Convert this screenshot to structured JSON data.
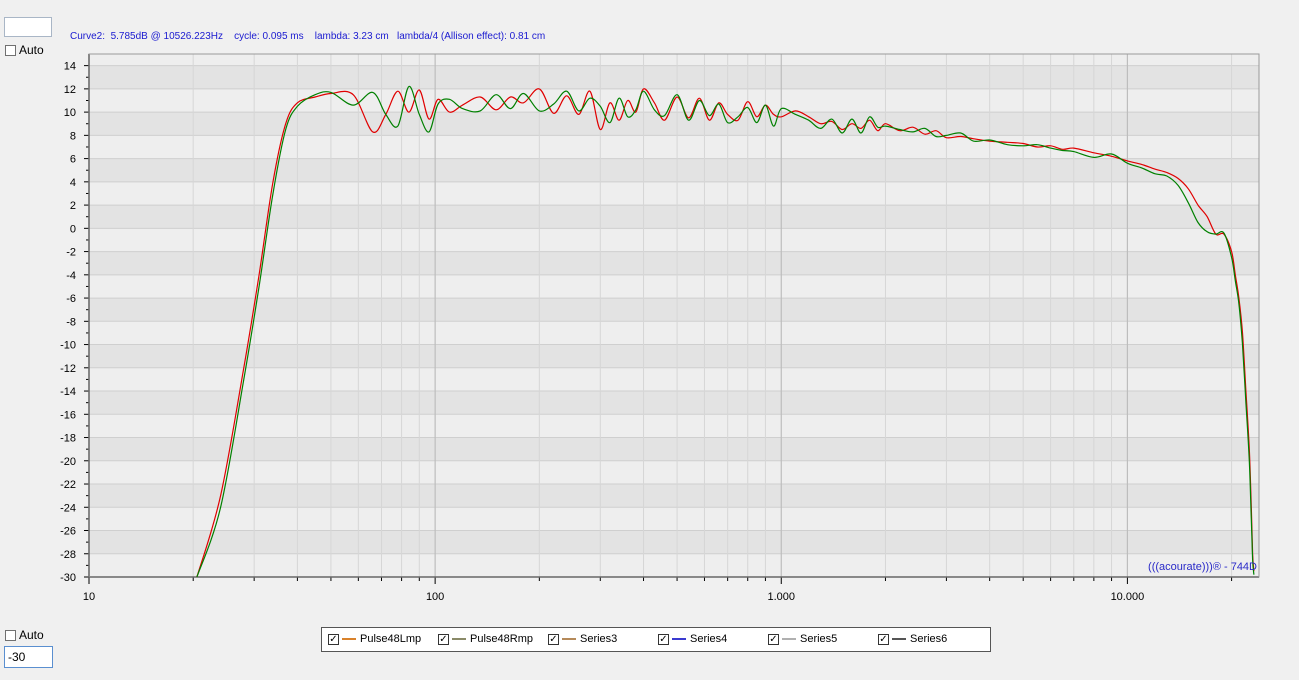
{
  "readout": "Curve2:  5.785dB @ 10526.223Hz    cycle: 0.095 ms    lambda: 3.23 cm   lambda/4 (Allison effect): 0.81 cm",
  "top_control": {
    "auto_label": "Auto",
    "value": ""
  },
  "bottom_control": {
    "auto_label": "Auto",
    "value": "-30"
  },
  "watermark": "(((acourate)))® - 744D",
  "legend": [
    {
      "name": "Pulse48Lmp",
      "color": "#d9822b"
    },
    {
      "name": "Pulse48Rmp",
      "color": "#8a8a68"
    },
    {
      "name": "Series3",
      "color": "#b58a5a"
    },
    {
      "name": "Series4",
      "color": "#3a3ad0"
    },
    {
      "name": "Series5",
      "color": "#b0b0b0"
    },
    {
      "name": "Series6",
      "color": "#555555"
    }
  ],
  "colors": {
    "red_curve": "#e00000",
    "green_curve": "#008000",
    "plot_bg_a": "#eeeeee",
    "plot_bg_b": "#e3e3e3"
  },
  "chart_data": {
    "type": "line",
    "xscale": "log",
    "xlim": [
      10,
      24000
    ],
    "ylim": [
      -30,
      15
    ],
    "xticks": [
      10,
      100,
      1000,
      10000
    ],
    "xtick_labels": [
      "10",
      "100",
      "1.000",
      "10.000"
    ],
    "yticks": [
      14,
      12,
      10,
      8,
      6,
      4,
      2,
      0,
      -2,
      -4,
      -6,
      -8,
      -10,
      -12,
      -14,
      -16,
      -18,
      -20,
      -22,
      -24,
      -26,
      -28,
      -30
    ],
    "grid": true,
    "series": [
      {
        "color": "#e00000",
        "x": [
          20.5,
          24,
          28,
          31,
          34,
          37,
          40,
          45,
          50,
          58,
          66,
          72,
          78,
          84,
          90,
          96,
          102,
          110,
          120,
          135,
          150,
          165,
          180,
          200,
          220,
          240,
          260,
          280,
          300,
          320,
          340,
          360,
          380,
          400,
          430,
          460,
          500,
          540,
          580,
          620,
          660,
          700,
          750,
          800,
          850,
          900,
          950,
          1000,
          1100,
          1200,
          1300,
          1400,
          1500,
          1600,
          1700,
          1800,
          1900,
          2000,
          2200,
          2400,
          2600,
          2800,
          3000,
          3300,
          3600,
          4000,
          4500,
          5000,
          5500,
          6000,
          6500,
          7000,
          8000,
          9000,
          10000,
          11000,
          12000,
          13000,
          14000,
          15000,
          16000,
          17000,
          18000,
          19000,
          20000,
          20500,
          21000,
          21500,
          22000,
          22500,
          22800,
          23000,
          23200
        ],
        "y": [
          -30,
          -23,
          -12,
          -4,
          4,
          9,
          10.8,
          11.3,
          11.6,
          11.5,
          8.3,
          9.8,
          11.8,
          10,
          11.9,
          9.4,
          11.1,
          10,
          10.6,
          11.3,
          10.2,
          11.3,
          10.8,
          12,
          9.9,
          11.4,
          9.8,
          11.8,
          8.5,
          10.8,
          9.3,
          11,
          10,
          12,
          10.8,
          9.3,
          11.3,
          9.5,
          11.2,
          9.3,
          10.8,
          9.8,
          9.3,
          10.9,
          9.6,
          10.6,
          9.8,
          9.6,
          10.1,
          9.6,
          9,
          9.2,
          8.5,
          9,
          8.6,
          9.3,
          8.4,
          9,
          8.4,
          8.7,
          8.1,
          8.4,
          7.8,
          7.9,
          7.7,
          7.5,
          7.4,
          7.3,
          7.0,
          7.1,
          6.8,
          6.9,
          6.5,
          6.2,
          5.8,
          5.5,
          5.1,
          4.8,
          4.3,
          3.4,
          2.0,
          1.0,
          -0.5,
          -0.5,
          -2,
          -4,
          -6,
          -9,
          -14,
          -19,
          -24,
          -28,
          -29.5
        ]
      },
      {
        "color": "#008000",
        "x": [
          20.5,
          24,
          28,
          31,
          34,
          37,
          40,
          45,
          50,
          58,
          66,
          72,
          78,
          84,
          90,
          96,
          102,
          110,
          120,
          135,
          150,
          165,
          180,
          200,
          220,
          240,
          260,
          280,
          300,
          320,
          340,
          360,
          380,
          400,
          430,
          460,
          500,
          540,
          580,
          620,
          660,
          700,
          750,
          800,
          850,
          900,
          950,
          1000,
          1100,
          1200,
          1300,
          1400,
          1500,
          1600,
          1700,
          1800,
          1900,
          2000,
          2200,
          2400,
          2600,
          2800,
          3000,
          3300,
          3600,
          4000,
          4500,
          5000,
          5500,
          6000,
          6500,
          7000,
          8000,
          9000,
          10000,
          11000,
          12000,
          13000,
          14000,
          15000,
          16000,
          17000,
          18000,
          19000,
          20000,
          20500,
          21000,
          21500,
          22000,
          22500,
          22800,
          23000,
          23200
        ],
        "y": [
          -30,
          -24,
          -13,
          -5,
          3,
          8.5,
          10.5,
          11.5,
          11.7,
          10.6,
          11.7,
          9.8,
          8.8,
          12.2,
          9.8,
          8.3,
          10.7,
          11.1,
          10.3,
          10.1,
          11.5,
          10.3,
          11.6,
          10.1,
          10.7,
          11.8,
          10.1,
          11.2,
          10.5,
          9.1,
          11.2,
          9.6,
          10.2,
          11.8,
          10.2,
          9.7,
          11.5,
          9.3,
          11,
          9.7,
          10.7,
          9.1,
          9.6,
          10.4,
          9.1,
          10.6,
          8.8,
          10.3,
          9.8,
          9.3,
          8.6,
          9.4,
          8.2,
          9.4,
          8.2,
          9.6,
          8.7,
          8.8,
          8.5,
          8.3,
          8.6,
          7.9,
          8.0,
          8.2,
          7.5,
          7.6,
          7.2,
          7.1,
          7.2,
          6.9,
          6.7,
          6.6,
          6.1,
          6.4,
          5.6,
          5.2,
          4.7,
          4.5,
          3.7,
          2.2,
          0.5,
          -0.3,
          -0.5,
          -0.4,
          -2.5,
          -4.5,
          -6.5,
          -10,
          -15,
          -20,
          -25,
          -28.5,
          -29.8
        ]
      }
    ]
  }
}
